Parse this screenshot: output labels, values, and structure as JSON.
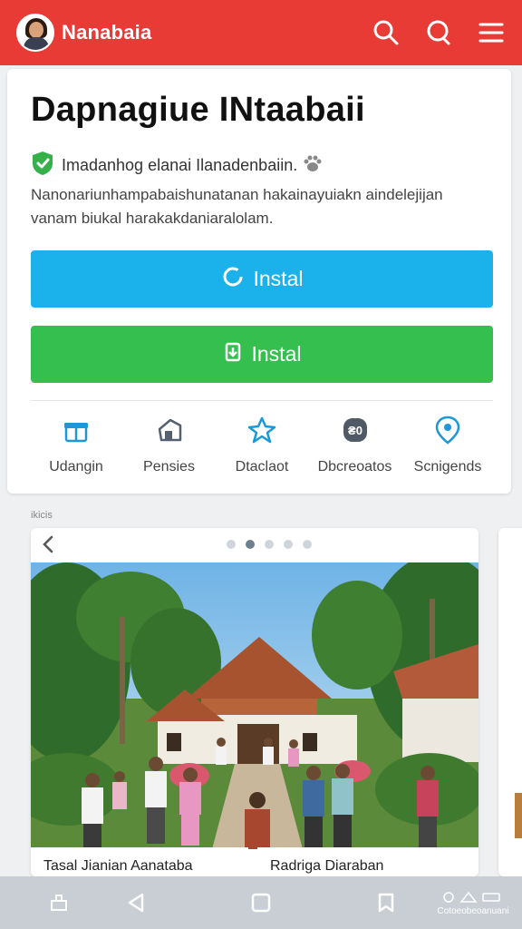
{
  "header": {
    "app_title": "Nanabaia",
    "actions": [
      {
        "icon": "search-icon"
      },
      {
        "icon": "search-icon"
      },
      {
        "icon": "menu-icon"
      }
    ]
  },
  "listing": {
    "title": "Dapnagiue INtaabaii",
    "verified_text": "Imadanhog elanai Ilanadenbaiin.",
    "description": "Nanonariunhampabaishunatanan hakainayuiakn aindelejijan vanam biukal harakakdaniaralolam.",
    "install_primary": "Instal",
    "install_secondary": "Instal"
  },
  "features": [
    {
      "label": "Udangin",
      "icon": "gift-icon"
    },
    {
      "label": "Pensies",
      "icon": "house-icon"
    },
    {
      "label": "Dtaclaot",
      "icon": "star-icon"
    },
    {
      "label": "Dbcreoatos",
      "icon": "badge-icon"
    },
    {
      "label": "Scnigends",
      "icon": "location-pin-icon"
    }
  ],
  "gallery": {
    "section_label": "ikicis",
    "dots_total": 5,
    "dots_active_index": 1,
    "captions": [
      "Tasal Jianian Aanataba",
      "Radriga Diaraban"
    ]
  },
  "navbar": {
    "right_text": "Cotoeobeoanuani"
  },
  "colors": {
    "topbar": "#e83b35",
    "install_primary": "#1bb1ea",
    "install_secondary": "#35bf4e",
    "verified": "#35b04a",
    "feature_icon": "#1c98d6"
  }
}
